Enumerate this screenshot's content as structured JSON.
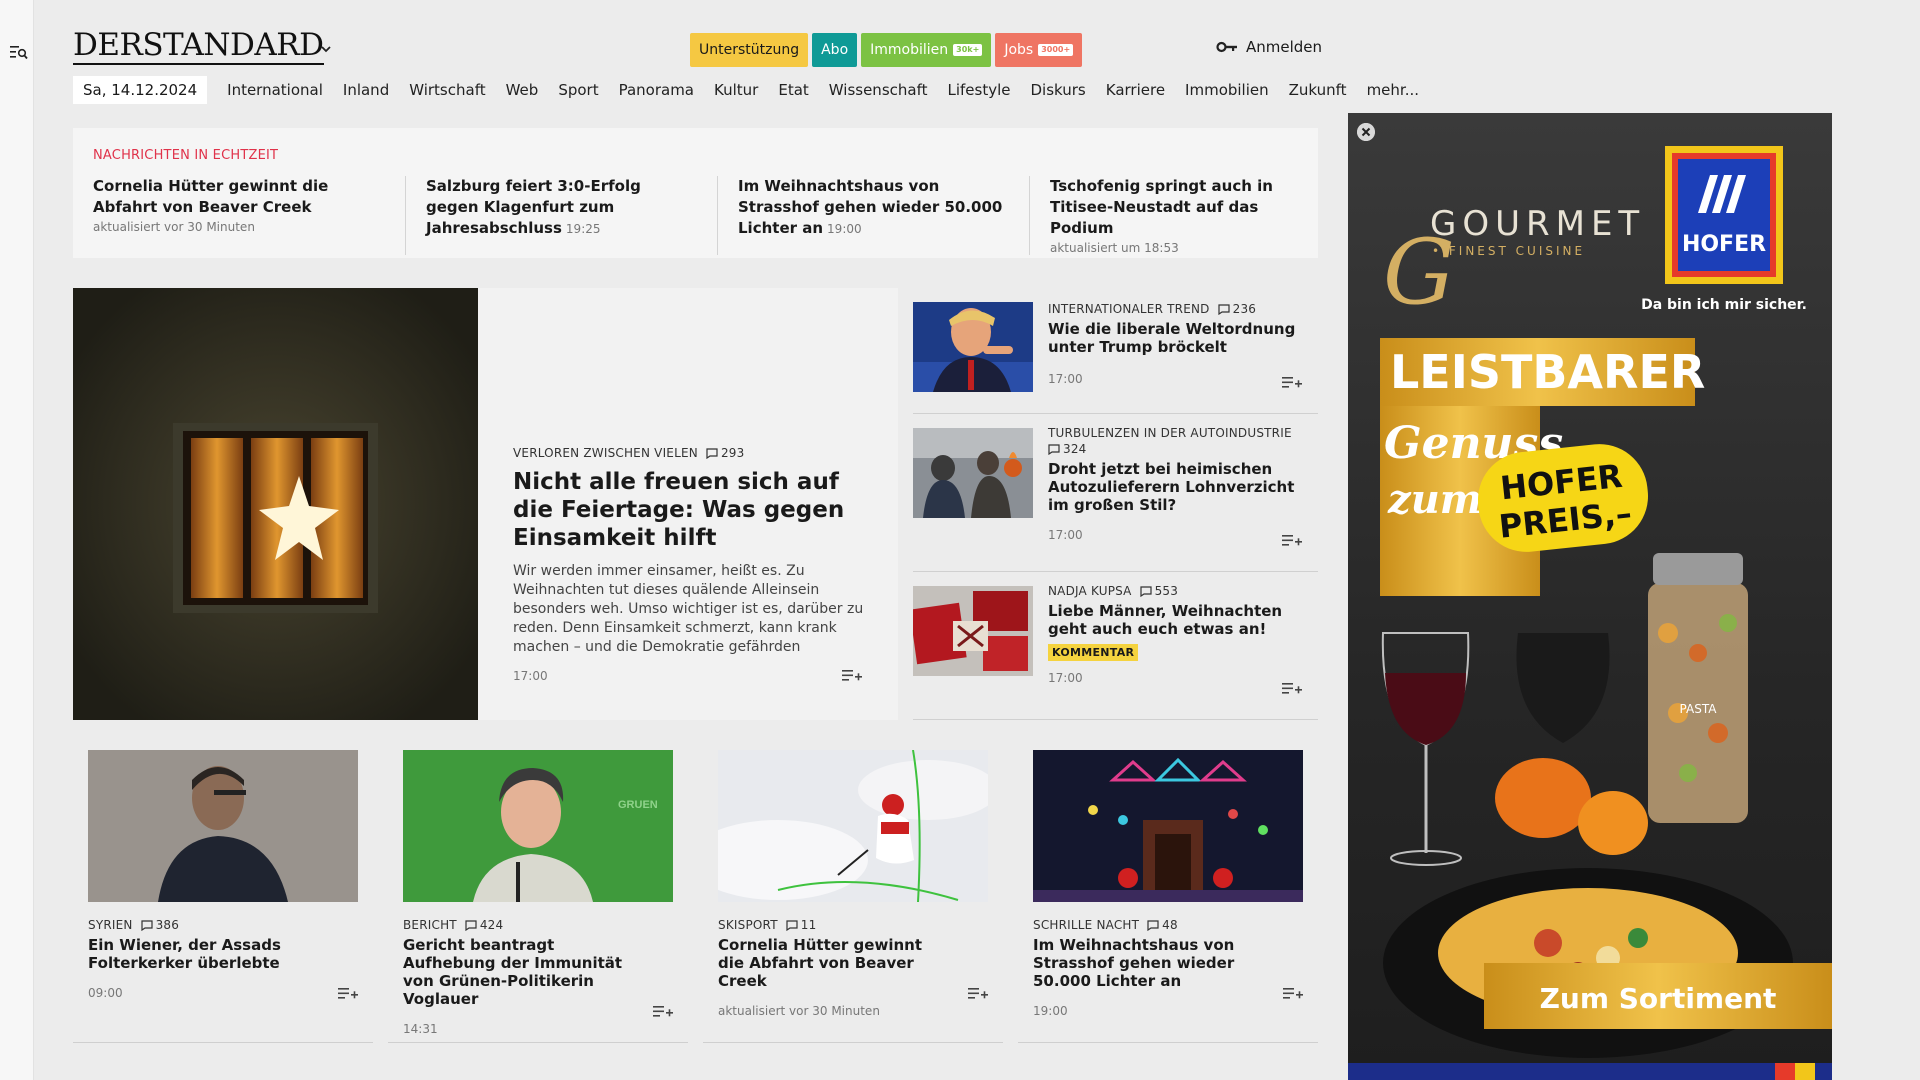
{
  "header": {
    "logo": "DERSTANDARD",
    "pills": [
      {
        "label": "Unterstützung",
        "badge": "",
        "bg": "#f5c842",
        "color": "#1a1a1a"
      },
      {
        "label": "Abo",
        "badge": "",
        "bg": "#0f9a96",
        "color": "#ffffff"
      },
      {
        "label": "Immobilien",
        "badge": "30k+",
        "bg": "#7cc243",
        "color": "#ffffff"
      },
      {
        "label": "Jobs",
        "badge": "3000+",
        "bg": "#ef7563",
        "color": "#ffffff"
      }
    ],
    "login_label": "Anmelden"
  },
  "nav": {
    "date": "Sa, 14.12.2024",
    "items": [
      "International",
      "Inland",
      "Wirtschaft",
      "Web",
      "Sport",
      "Panorama",
      "Kultur",
      "Etat",
      "Wissenschaft",
      "Lifestyle",
      "Diskurs",
      "Karriere",
      "Immobilien",
      "Zukunft",
      "mehr..."
    ]
  },
  "ticker": {
    "heading": "NACHRICHTEN IN ECHTZEIT",
    "items": [
      {
        "title": "Cornelia Hütter gewinnt die Abfahrt von Beaver Creek",
        "time": "",
        "meta": "aktualisiert vor 30 Minuten"
      },
      {
        "title": "Salzburg feiert 3:0-Erfolg gegen Klagenfurt zum Jahresabschluss",
        "time": "19:25",
        "meta": ""
      },
      {
        "title": "Im Weihnachtshaus von Strasshof gehen wieder 50.000 Lichter an",
        "time": "19:00",
        "meta": ""
      },
      {
        "title": "Tschofenig springt auch in Titisee-Neustadt auf das Podium",
        "time": "",
        "meta": "aktualisiert um 18:53"
      }
    ]
  },
  "hero": {
    "kicker": "VERLOREN ZWISCHEN VIELEN",
    "comments": "293",
    "title": "Nicht alle freuen sich auf die Feiertage: Was gegen Einsamkeit hilft",
    "lead": "Wir werden immer einsamer, heißt es. Zu Weihnachten tut dieses quälende Alleinsein besonders weh. Umso wichtiger ist es, darüber zu reden. Denn Einsamkeit schmerzt, kann krank machen – und die Demokratie gefährden",
    "time": "17:00"
  },
  "side": [
    {
      "kicker": "INTERNATIONALER TREND",
      "comments": "236",
      "title": "Wie die liberale Weltordnung unter Trump bröckelt",
      "tag": "",
      "time": "17:00"
    },
    {
      "kicker": "TURBULENZEN IN DER AUTOINDUSTRIE",
      "comments": "324",
      "title": "Droht jetzt bei heimischen Autozulieferern Lohnverzicht im großen Stil?",
      "tag": "",
      "time": "17:00"
    },
    {
      "kicker": "NADJA KUPSA",
      "comments": "553",
      "title": "Liebe Männer, Weihnachten geht auch euch etwas an!",
      "tag": "KOMMENTAR",
      "time": "17:00"
    }
  ],
  "cards": [
    {
      "kicker": "SYRIEN",
      "comments": "386",
      "title": "Ein Wiener, der Assads Folterkerker überlebte",
      "time": "09:00"
    },
    {
      "kicker": "BERICHT",
      "comments": "424",
      "title": "Gericht beantragt Aufhebung der Immunität von Grünen-Politikerin Voglauer",
      "time": "14:31"
    },
    {
      "kicker": "SKISPORT",
      "comments": "11",
      "title": "Cornelia Hütter gewinnt die Abfahrt von Beaver Creek",
      "time": "aktualisiert vor 30 Minuten"
    },
    {
      "kicker": "SCHRILLE NACHT",
      "comments": "48",
      "title": "Im Weihnachtshaus von Strasshof gehen wieder 50.000 Lichter an",
      "time": "19:00"
    }
  ],
  "ad": {
    "brand_line1": "GOURMET",
    "brand_line2": "• FINEST CUISINE",
    "store": "HOFER",
    "slogan": "Da bin ich mir sicher.",
    "headline": "LEISTBARER",
    "script1": "Genuss",
    "script2": "zum",
    "badge1": "HOFER",
    "badge2": "PREIS,–",
    "cta": "Zum Sortiment",
    "jar_label": "PASTA"
  }
}
